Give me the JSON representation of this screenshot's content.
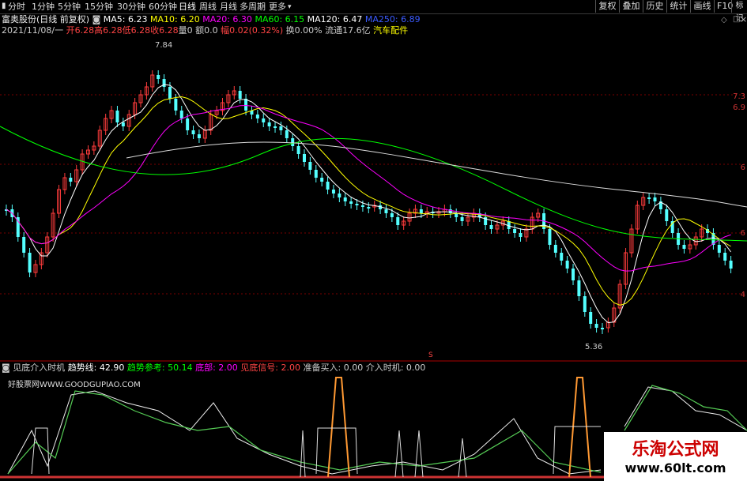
{
  "toolbar": {
    "timeframes": [
      "分时",
      "1分钟",
      "5分钟",
      "15分钟",
      "30分钟",
      "60分钟",
      "日线",
      "周线",
      "月线",
      "多周期",
      "更多"
    ],
    "right_buttons": [
      "复权",
      "叠加",
      "历史",
      "统计",
      "画线",
      "F10",
      "标记"
    ],
    "window_glyph": "□",
    "close_glyph": "×"
  },
  "main_info": {
    "stock": "富奥股份(日线 前复权)",
    "ma5": "MA5: 6.23",
    "ma10": "MA10: 6.20",
    "ma20": "MA20: 6.30",
    "ma60": "MA60: 6.15",
    "ma120": "MA120: 6.47",
    "ma250": "MA250: 6.89",
    "date": "2021/11/08/一",
    "open": "开6.28",
    "high": "高6.28",
    "low": "低6.28",
    "close": "收6.28",
    "vol": "量0",
    "amount": "额0.0",
    "change": "幅0.02(0.32%)",
    "turnover": "换0.00%",
    "float": "流通17.6亿",
    "sector": "汽车配件",
    "high_mark": "7.84",
    "low_mark": "5.36",
    "s_mark": "S"
  },
  "axis_labels": [
    "7.3",
    "6.9",
    "6",
    "6",
    "4"
  ],
  "sub_info": {
    "name": "见底介入时机",
    "trend": "趋势线: 42.90",
    "trend_ref": "趋势参考: 50.14",
    "bottom": "底部: 2.00",
    "signal": "见底信号: 2.00",
    "prepare": "准备买入: 0.00",
    "entry": "介入时机: 0.00",
    "source": "好股票网WWW.GOODGUPIAO.COM"
  },
  "watermark": {
    "title": "乐淘公式网",
    "url": "www.60lt.com"
  },
  "colors": {
    "up": "#ff3c3c",
    "down": "#54ffff",
    "ma5": "#ffffff",
    "ma10": "#ffff00",
    "ma20": "#ff00ff",
    "ma60": "#00ff00",
    "ma120": "#ffffff",
    "ma250": "#3b5bff",
    "grid": "#7a0000"
  }
}
